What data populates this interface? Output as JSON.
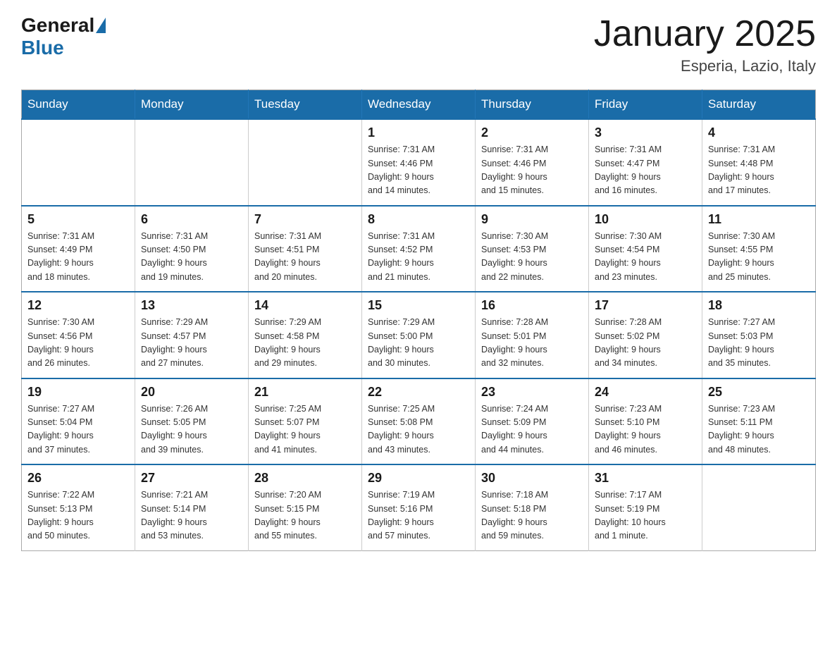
{
  "logo": {
    "general": "General",
    "blue": "Blue"
  },
  "title": "January 2025",
  "location": "Esperia, Lazio, Italy",
  "days_of_week": [
    "Sunday",
    "Monday",
    "Tuesday",
    "Wednesday",
    "Thursday",
    "Friday",
    "Saturday"
  ],
  "weeks": [
    [
      {
        "day": "",
        "info": ""
      },
      {
        "day": "",
        "info": ""
      },
      {
        "day": "",
        "info": ""
      },
      {
        "day": "1",
        "info": "Sunrise: 7:31 AM\nSunset: 4:46 PM\nDaylight: 9 hours\nand 14 minutes."
      },
      {
        "day": "2",
        "info": "Sunrise: 7:31 AM\nSunset: 4:46 PM\nDaylight: 9 hours\nand 15 minutes."
      },
      {
        "day": "3",
        "info": "Sunrise: 7:31 AM\nSunset: 4:47 PM\nDaylight: 9 hours\nand 16 minutes."
      },
      {
        "day": "4",
        "info": "Sunrise: 7:31 AM\nSunset: 4:48 PM\nDaylight: 9 hours\nand 17 minutes."
      }
    ],
    [
      {
        "day": "5",
        "info": "Sunrise: 7:31 AM\nSunset: 4:49 PM\nDaylight: 9 hours\nand 18 minutes."
      },
      {
        "day": "6",
        "info": "Sunrise: 7:31 AM\nSunset: 4:50 PM\nDaylight: 9 hours\nand 19 minutes."
      },
      {
        "day": "7",
        "info": "Sunrise: 7:31 AM\nSunset: 4:51 PM\nDaylight: 9 hours\nand 20 minutes."
      },
      {
        "day": "8",
        "info": "Sunrise: 7:31 AM\nSunset: 4:52 PM\nDaylight: 9 hours\nand 21 minutes."
      },
      {
        "day": "9",
        "info": "Sunrise: 7:30 AM\nSunset: 4:53 PM\nDaylight: 9 hours\nand 22 minutes."
      },
      {
        "day": "10",
        "info": "Sunrise: 7:30 AM\nSunset: 4:54 PM\nDaylight: 9 hours\nand 23 minutes."
      },
      {
        "day": "11",
        "info": "Sunrise: 7:30 AM\nSunset: 4:55 PM\nDaylight: 9 hours\nand 25 minutes."
      }
    ],
    [
      {
        "day": "12",
        "info": "Sunrise: 7:30 AM\nSunset: 4:56 PM\nDaylight: 9 hours\nand 26 minutes."
      },
      {
        "day": "13",
        "info": "Sunrise: 7:29 AM\nSunset: 4:57 PM\nDaylight: 9 hours\nand 27 minutes."
      },
      {
        "day": "14",
        "info": "Sunrise: 7:29 AM\nSunset: 4:58 PM\nDaylight: 9 hours\nand 29 minutes."
      },
      {
        "day": "15",
        "info": "Sunrise: 7:29 AM\nSunset: 5:00 PM\nDaylight: 9 hours\nand 30 minutes."
      },
      {
        "day": "16",
        "info": "Sunrise: 7:28 AM\nSunset: 5:01 PM\nDaylight: 9 hours\nand 32 minutes."
      },
      {
        "day": "17",
        "info": "Sunrise: 7:28 AM\nSunset: 5:02 PM\nDaylight: 9 hours\nand 34 minutes."
      },
      {
        "day": "18",
        "info": "Sunrise: 7:27 AM\nSunset: 5:03 PM\nDaylight: 9 hours\nand 35 minutes."
      }
    ],
    [
      {
        "day": "19",
        "info": "Sunrise: 7:27 AM\nSunset: 5:04 PM\nDaylight: 9 hours\nand 37 minutes."
      },
      {
        "day": "20",
        "info": "Sunrise: 7:26 AM\nSunset: 5:05 PM\nDaylight: 9 hours\nand 39 minutes."
      },
      {
        "day": "21",
        "info": "Sunrise: 7:25 AM\nSunset: 5:07 PM\nDaylight: 9 hours\nand 41 minutes."
      },
      {
        "day": "22",
        "info": "Sunrise: 7:25 AM\nSunset: 5:08 PM\nDaylight: 9 hours\nand 43 minutes."
      },
      {
        "day": "23",
        "info": "Sunrise: 7:24 AM\nSunset: 5:09 PM\nDaylight: 9 hours\nand 44 minutes."
      },
      {
        "day": "24",
        "info": "Sunrise: 7:23 AM\nSunset: 5:10 PM\nDaylight: 9 hours\nand 46 minutes."
      },
      {
        "day": "25",
        "info": "Sunrise: 7:23 AM\nSunset: 5:11 PM\nDaylight: 9 hours\nand 48 minutes."
      }
    ],
    [
      {
        "day": "26",
        "info": "Sunrise: 7:22 AM\nSunset: 5:13 PM\nDaylight: 9 hours\nand 50 minutes."
      },
      {
        "day": "27",
        "info": "Sunrise: 7:21 AM\nSunset: 5:14 PM\nDaylight: 9 hours\nand 53 minutes."
      },
      {
        "day": "28",
        "info": "Sunrise: 7:20 AM\nSunset: 5:15 PM\nDaylight: 9 hours\nand 55 minutes."
      },
      {
        "day": "29",
        "info": "Sunrise: 7:19 AM\nSunset: 5:16 PM\nDaylight: 9 hours\nand 57 minutes."
      },
      {
        "day": "30",
        "info": "Sunrise: 7:18 AM\nSunset: 5:18 PM\nDaylight: 9 hours\nand 59 minutes."
      },
      {
        "day": "31",
        "info": "Sunrise: 7:17 AM\nSunset: 5:19 PM\nDaylight: 10 hours\nand 1 minute."
      },
      {
        "day": "",
        "info": ""
      }
    ]
  ]
}
